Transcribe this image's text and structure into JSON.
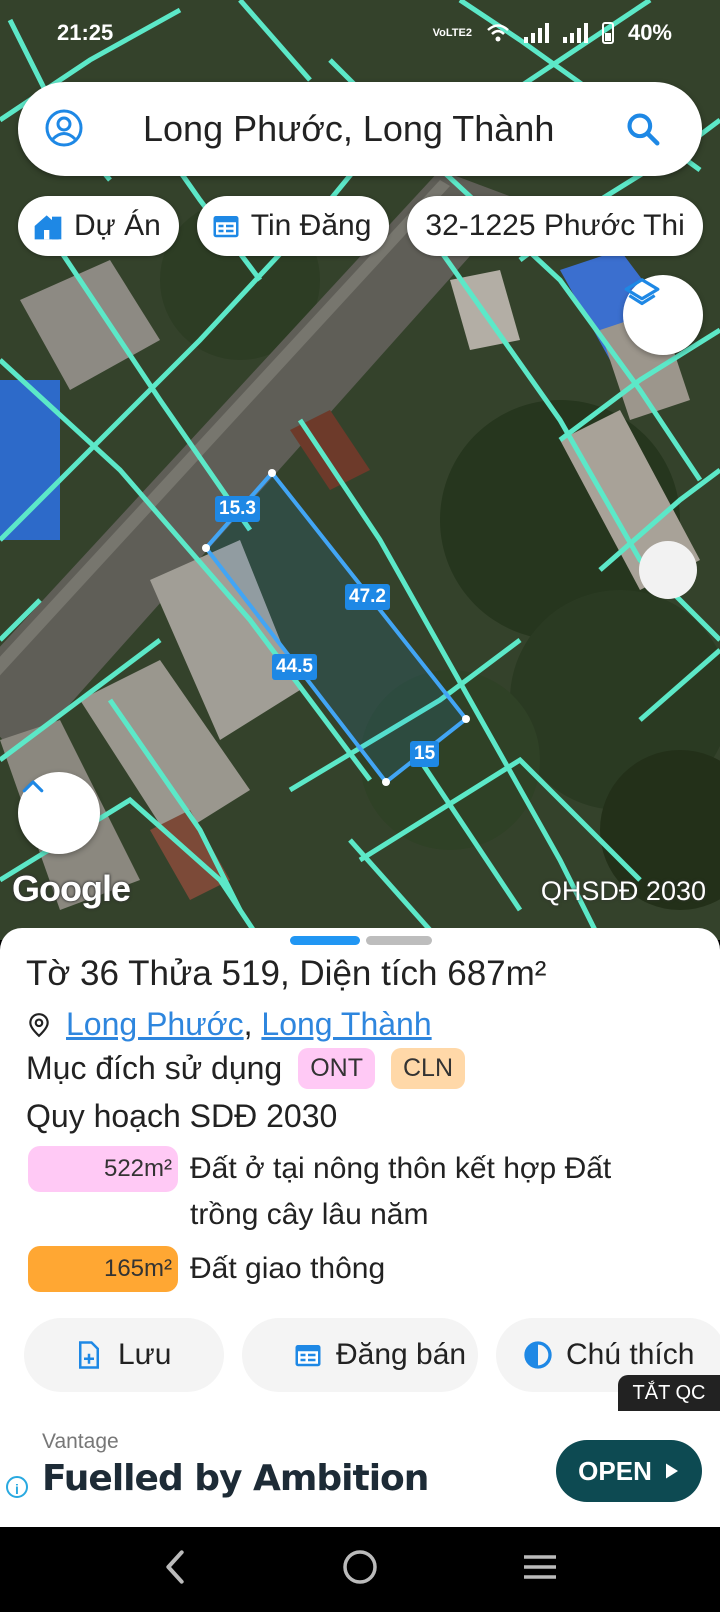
{
  "status_bar": {
    "time": "21:25",
    "network": "VoLTE2",
    "battery": "40%"
  },
  "search": {
    "text": "Long Phước, Long Thành"
  },
  "chips": [
    {
      "label": "Dự Án",
      "icon": "house-icon"
    },
    {
      "label": "Tin Đăng",
      "icon": "calendar-icon"
    },
    {
      "label": "32-1225 Phước Thi"
    }
  ],
  "map": {
    "google_label": "Google",
    "layer_label": "QHSDĐ 2030",
    "dimensions": [
      "15.3",
      "47.2",
      "44.5",
      "15"
    ]
  },
  "sheet": {
    "title": "Tờ 36 Thửa 519, Diện tích 687m²",
    "location_links": [
      "Long Phước",
      "Long Thành"
    ],
    "location_separator": ", ",
    "purpose_label": "Mục đích sử dụng",
    "purpose_badges": [
      {
        "code": "ONT",
        "color": "#ffc9f5"
      },
      {
        "code": "CLN",
        "color": "#ffd8a8"
      }
    ],
    "plan_title": "Quy hoạch SDĐ 2030",
    "zones": [
      {
        "area": "522m²",
        "desc": "Đất ở tại nông thôn kết hợp Đất trồng cây lâu năm",
        "color": "#ffc9f5"
      },
      {
        "area": "165m²",
        "desc": "Đất giao thông",
        "color": "#ffa733"
      }
    ],
    "actions": [
      {
        "label": "Lưu",
        "icon": "file-add-icon"
      },
      {
        "label": "Đăng bán",
        "icon": "calendar-icon"
      },
      {
        "label": "Chú thích",
        "icon": "contrast-icon"
      }
    ]
  },
  "ad": {
    "close_label": "TẮT QC",
    "brand": "Vantage",
    "headline": "Fuelled by Ambition",
    "cta": "OPEN"
  },
  "colors": {
    "accent": "#2196f3",
    "plot_outline": "#42a5f5",
    "parcel_lines": "#5ce8c8"
  }
}
